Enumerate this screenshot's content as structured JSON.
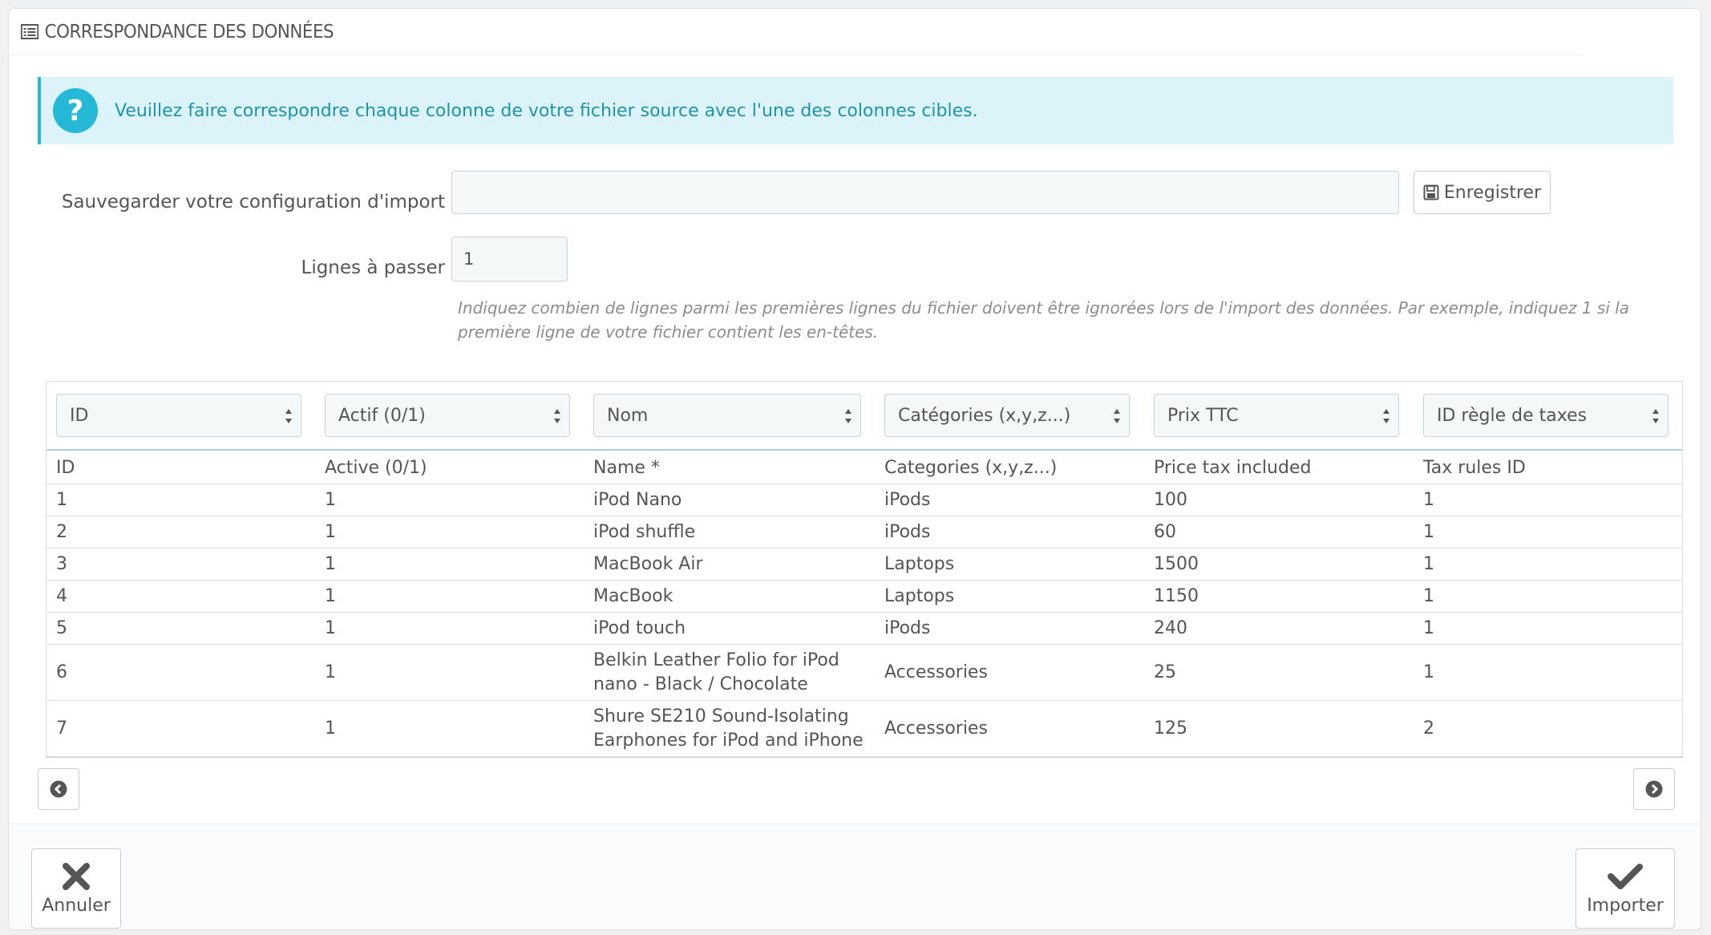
{
  "panel": {
    "title": "CORRESPONDANCE DES DONNÉES"
  },
  "alert": {
    "text": "Veuillez faire correspondre chaque colonne de votre fichier source avec l'une des colonnes cibles."
  },
  "config": {
    "label": "Sauvegarder votre configuration d'import",
    "value": "",
    "save_label": "Enregistrer"
  },
  "skip": {
    "label": "Lignes à passer",
    "value": "1",
    "help": "Indiquez combien de lignes parmi les premières lignes du fichier doivent être ignorées lors de l'import des données. Par exemple, indiquez 1 si la première ligne de votre fichier contient les en-têtes."
  },
  "table": {
    "selects": [
      "ID",
      "Actif (0/1)",
      "Nom",
      "Catégories (x,y,z...)",
      "Prix TTC",
      "ID règle de taxes"
    ],
    "headers": [
      "ID",
      "Active (0/1)",
      "Name *",
      "Categories (x,y,z...)",
      "Price tax included",
      "Tax rules ID"
    ],
    "rows": [
      [
        "1",
        "1",
        "iPod Nano",
        "iPods",
        "100",
        "1"
      ],
      [
        "2",
        "1",
        "iPod shuffle",
        "iPods",
        "60",
        "1"
      ],
      [
        "3",
        "1",
        "MacBook Air",
        "Laptops",
        "1500",
        "1"
      ],
      [
        "4",
        "1",
        "MacBook",
        "Laptops",
        "1150",
        "1"
      ],
      [
        "5",
        "1",
        "iPod touch",
        "iPods",
        "240",
        "1"
      ],
      [
        "6",
        "1",
        "Belkin Leather Folio for iPod nano - Black / Chocolate",
        "Accessories",
        "25",
        "1"
      ],
      [
        "7",
        "1",
        "Shure SE210 Sound-Isolating Earphones for iPod and iPhone",
        "Accessories",
        "125",
        "2"
      ]
    ]
  },
  "footer": {
    "cancel_label": "Annuler",
    "import_label": "Importer"
  },
  "colors": {
    "accent": "#25b9d7",
    "alert_bg": "#dcf4f9",
    "alert_text": "#1e94ab"
  }
}
